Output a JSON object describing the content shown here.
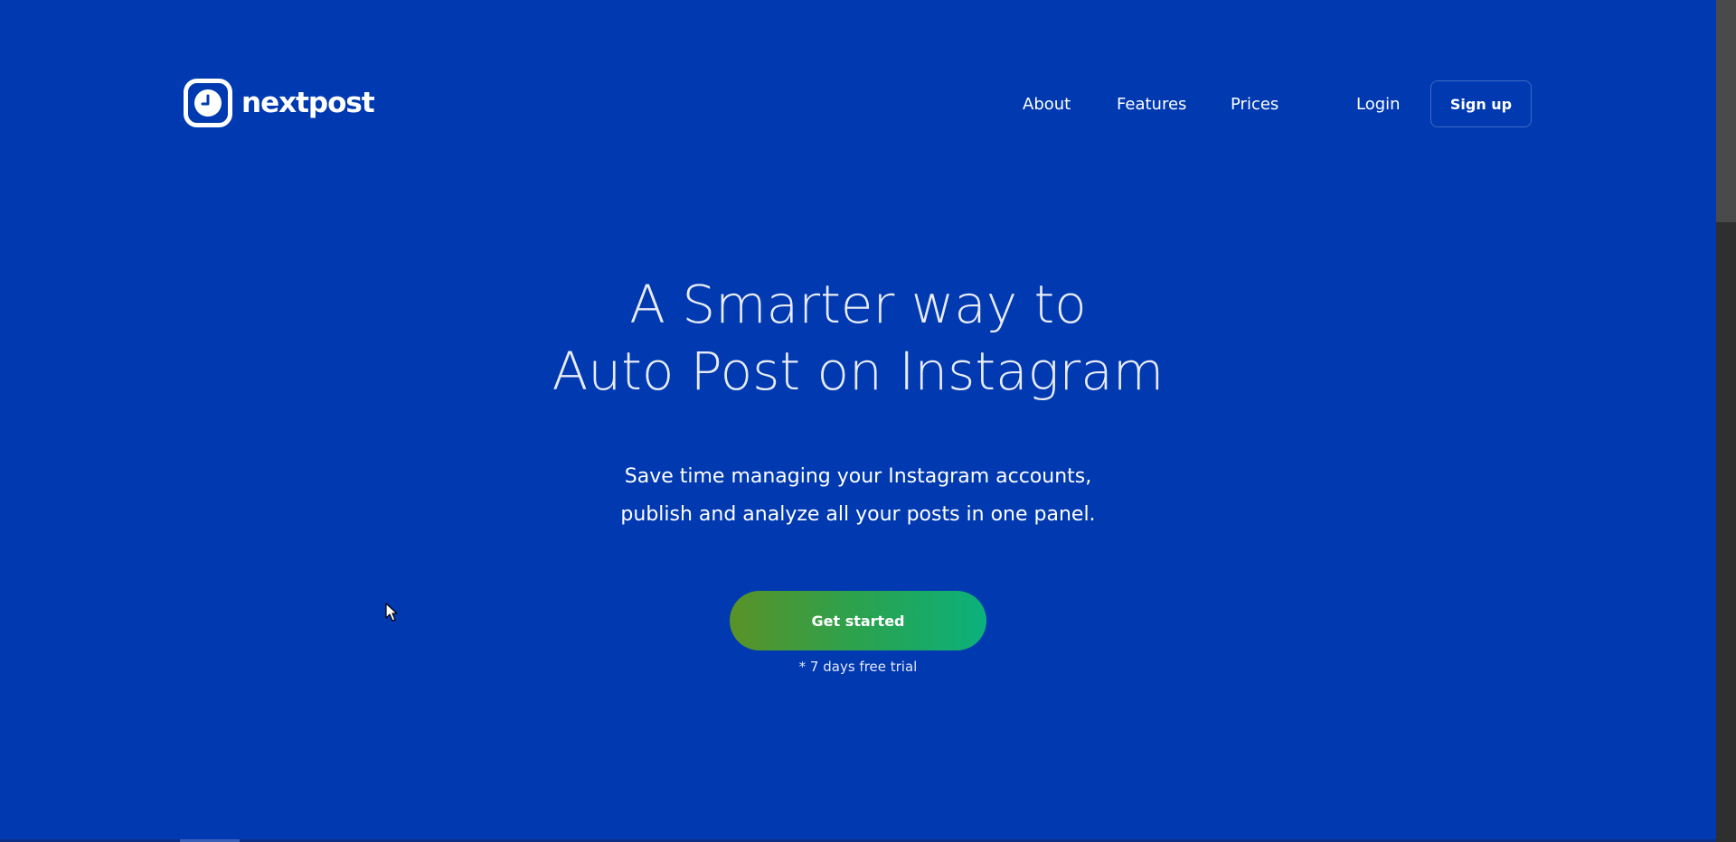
{
  "brand": {
    "name": "nextpost",
    "logo_icon": "clock-icon",
    "color": "#0039b0"
  },
  "nav": {
    "items": [
      {
        "label": "About"
      },
      {
        "label": "Features"
      },
      {
        "label": "Prices"
      }
    ],
    "login_label": "Login",
    "signup_label": "Sign up"
  },
  "hero": {
    "title_line1": "A Smarter way to",
    "title_line2": "Auto Post on Instagram",
    "subtitle_line1": "Save time managing your Instagram accounts,",
    "subtitle_line2": "publish and analyze all your posts in one panel.",
    "cta_label": "Get started",
    "trial_note": "* 7 days free trial"
  },
  "colors": {
    "background": "#0039b0",
    "cta_gradient_start": "#5a9227",
    "cta_gradient_end": "#0bb17c",
    "text": "#ffffff"
  },
  "cursor_icon": "mouse-pointer-icon"
}
